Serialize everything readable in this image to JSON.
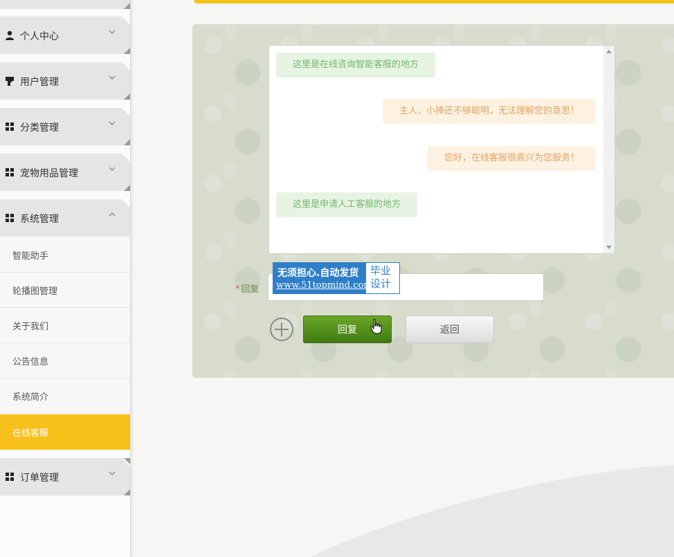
{
  "sidebar": {
    "menus": [
      {
        "label": "个人中心",
        "icon": "user-icon",
        "expanded": false
      },
      {
        "label": "用户管理",
        "icon": "stamp-icon",
        "expanded": false
      },
      {
        "label": "分类管理",
        "icon": "grid-icon",
        "expanded": false
      },
      {
        "label": "宠物用品管理",
        "icon": "grid-icon",
        "expanded": false
      },
      {
        "label": "系统管理",
        "icon": "grid-icon",
        "expanded": true
      },
      {
        "label": "订单管理",
        "icon": "grid-icon",
        "expanded": false
      }
    ],
    "submenu": [
      {
        "label": "智能助手",
        "active": false
      },
      {
        "label": "轮播图管理",
        "active": false
      },
      {
        "label": "关于我们",
        "active": false
      },
      {
        "label": "公告信息",
        "active": false
      },
      {
        "label": "系统简介",
        "active": false
      },
      {
        "label": "在线客服",
        "active": true
      }
    ]
  },
  "chat": {
    "messages": [
      {
        "text": "这里是在线咨询智能客服的地方",
        "side": "left"
      },
      {
        "text": "主人，小捧还不够聪明，无法理解您的意思！",
        "side": "right"
      },
      {
        "text": "您好，在线客服很高兴为您服务！",
        "side": "right"
      },
      {
        "text": "这里是申请人工客服的地方",
        "side": "left"
      }
    ]
  },
  "form": {
    "required_mark": "*",
    "reply_label": "回复",
    "reply_value": "",
    "reply_button": "回复",
    "return_button": "返回"
  },
  "watermark": {
    "line1": "无须担心.自动发货",
    "line2": "www.51topmind.com",
    "right_line1": "毕业",
    "right_line2": "设计"
  },
  "colors": {
    "accent": "#f8c01a",
    "reply_button": "#4f8c1a",
    "chat_left_bg": "#e8f4e3",
    "chat_right_bg": "#fdf2e1",
    "panel_bg": "#d7dccd"
  }
}
